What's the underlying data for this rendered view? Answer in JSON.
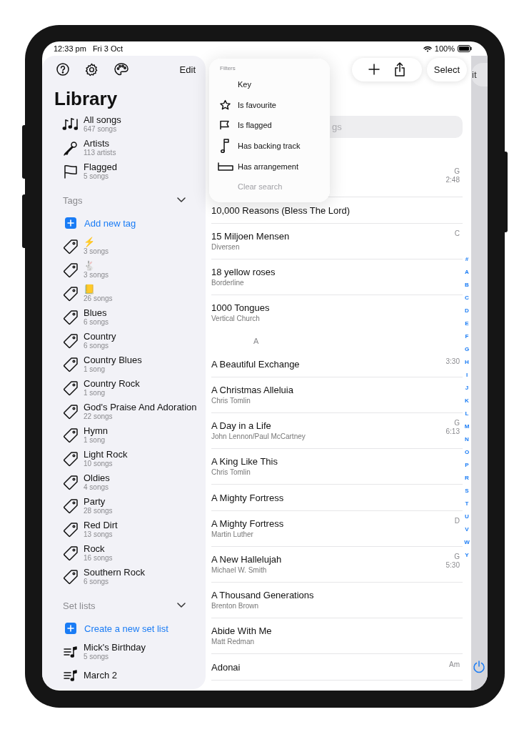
{
  "status_bar": {
    "time": "12:33 pm",
    "date": "Fri 3 Oct",
    "battery": "100%"
  },
  "sidebar": {
    "edit_label": "Edit",
    "title": "Library",
    "items": [
      {
        "kind": "songs",
        "title": "All songs",
        "subtitle": "647 songs"
      },
      {
        "kind": "artists",
        "title": "Artists",
        "subtitle": "113 artists"
      },
      {
        "kind": "flagged",
        "title": "Flagged",
        "subtitle": "5 songs"
      }
    ],
    "tags": {
      "header": "Tags",
      "expanded": true,
      "add_label": "Add new tag",
      "items": [
        {
          "title": "⚡",
          "subtitle": "3 songs"
        },
        {
          "title": "🐇",
          "subtitle": "3 songs"
        },
        {
          "title": "📒",
          "subtitle": "26 songs"
        },
        {
          "title": "Blues",
          "subtitle": "6 songs"
        },
        {
          "title": "Country",
          "subtitle": "6 songs"
        },
        {
          "title": "Country Blues",
          "subtitle": "1 song"
        },
        {
          "title": "Country Rock",
          "subtitle": "1 song"
        },
        {
          "title": "God's Praise And Adoration",
          "subtitle": "22 songs"
        },
        {
          "title": "Hymn",
          "subtitle": "1 song"
        },
        {
          "title": "Light Rock",
          "subtitle": "10 songs"
        },
        {
          "title": "Oldies",
          "subtitle": "4 songs"
        },
        {
          "title": "Party",
          "subtitle": "28 songs"
        },
        {
          "title": "Red Dirt",
          "subtitle": "13 songs"
        },
        {
          "title": "Rock",
          "subtitle": "16 songs"
        },
        {
          "title": "Southern Rock",
          "subtitle": "6 songs"
        }
      ]
    },
    "set_lists": {
      "header": "Set lists",
      "expanded": true,
      "add_label": "Create a new set list",
      "items": [
        {
          "title": "Mick's Birthday",
          "subtitle": "5 songs"
        },
        {
          "title": "March 2"
        }
      ]
    }
  },
  "toolbar": {
    "select_label": "Select"
  },
  "search": {
    "placeholder": "gs"
  },
  "filter_menu": {
    "title": "Filters",
    "items": [
      {
        "kind": "key",
        "label": "Key",
        "disabled": false
      },
      {
        "kind": "favourite",
        "label": "Is favourite",
        "disabled": false
      },
      {
        "kind": "flagged",
        "label": "Is flagged",
        "disabled": false
      },
      {
        "kind": "backing",
        "label": "Has backing track",
        "disabled": false
      },
      {
        "kind": "arrangement",
        "label": "Has arrangement",
        "disabled": false
      },
      {
        "kind": "clear",
        "label": "Clear search",
        "disabled": true
      }
    ]
  },
  "songs": [
    {
      "kind": "song",
      "key": "G",
      "duration": "2:48"
    },
    {
      "kind": "song",
      "title": "10,000 Reasons (Bless The Lord)"
    },
    {
      "kind": "song",
      "title": "15 Miljoen Mensen",
      "artist": "Diversen",
      "key": "C"
    },
    {
      "kind": "song",
      "title": "18 yellow roses",
      "artist": "Borderline"
    },
    {
      "kind": "song",
      "title": "1000 Tongues",
      "artist": "Vertical Church"
    },
    {
      "kind": "section",
      "title": "A"
    },
    {
      "kind": "song",
      "title": "A Beautiful Exchange",
      "duration": "3:30"
    },
    {
      "kind": "song",
      "title": "A Christmas Alleluia",
      "artist": "Chris Tomlin"
    },
    {
      "kind": "song",
      "title": "A Day in a Life",
      "artist": "John Lennon/Paul McCartney",
      "key": "G",
      "duration": "6:13"
    },
    {
      "kind": "song",
      "title": "A King Like This",
      "artist": "Chris Tomlin"
    },
    {
      "kind": "song",
      "title": "A Mighty Fortress"
    },
    {
      "kind": "song",
      "title": "A Mighty Fortress",
      "artist": "Martin Luther",
      "key": "D"
    },
    {
      "kind": "song",
      "title": "A New Hallelujah",
      "artist": "Michael W. Smith",
      "key": "G",
      "duration": "5:30"
    },
    {
      "kind": "song",
      "title": "A Thousand Generations",
      "artist": "Brenton Brown"
    },
    {
      "kind": "song",
      "title": "Abide With Me",
      "artist": "Matt Redman"
    },
    {
      "kind": "song",
      "title": "Adonai",
      "key": "Am"
    }
  ],
  "index": [
    "#",
    "A",
    "B",
    "C",
    "D",
    "E",
    "F",
    "G",
    "H",
    "I",
    "J",
    "K",
    "L",
    "M",
    "N",
    "O",
    "P",
    "R",
    "S",
    "T",
    "U",
    "V",
    "W",
    "Y"
  ],
  "side_panel": {
    "edit_label": "it"
  }
}
